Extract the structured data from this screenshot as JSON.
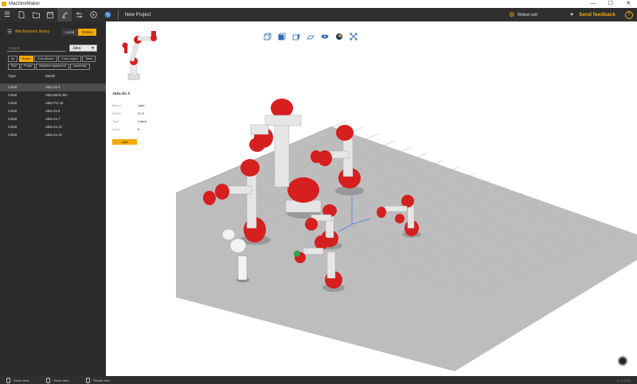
{
  "window": {
    "title": "MachineMaker",
    "minimize": "—",
    "maximize": "☐",
    "close": "✕"
  },
  "toolbar": {
    "project_title": "New Project",
    "robot_cell_label": "Robot cell",
    "feedback_label": "Send feedback",
    "help_label": "?"
  },
  "library": {
    "title": "Mechanisms library",
    "tab_local": "Local",
    "tab_online": "Online",
    "search_placeholder": "Search",
    "brand_value": "Jaka",
    "filters": [
      "All",
      "Robot",
      "End effector",
      "Fixed object",
      "Table",
      "Rail",
      "Portal",
      "Machine equipment",
      "Assembly"
    ],
    "col_type": "Type",
    "col_model": "Model",
    "rows": [
      {
        "type": "Cobot",
        "model": "Jaka Zu 3"
      },
      {
        "type": "Cobot",
        "model": "Jaka MiniCobo"
      },
      {
        "type": "Cobot",
        "model": "Jaka Pro 16"
      },
      {
        "type": "Cobot",
        "model": "Jaka Zu 5"
      },
      {
        "type": "Cobot",
        "model": "Jaka Zu 7"
      },
      {
        "type": "Cobot",
        "model": "Jaka Zu 12"
      },
      {
        "type": "Cobot",
        "model": "Jaka Zu 18"
      }
    ]
  },
  "detail": {
    "name": "Jaka Zu 3",
    "brand_key": "Brand",
    "brand_val": "Jaka",
    "model_key": "Model",
    "model_val": "Zu 3",
    "type_key": "Type",
    "type_val": "Cobot",
    "axes_key": "Axes",
    "axes_val": "6",
    "add_label": "Add"
  },
  "statusbar": {
    "zoom": "Zoom view",
    "move": "Move view",
    "rotate": "Rotate view",
    "version": "v1.3.1234"
  },
  "colors": {
    "accent": "#f2a900",
    "panel": "#2b2b2b",
    "robot_red": "#d61f1f",
    "floor": "#bdbdbd"
  }
}
